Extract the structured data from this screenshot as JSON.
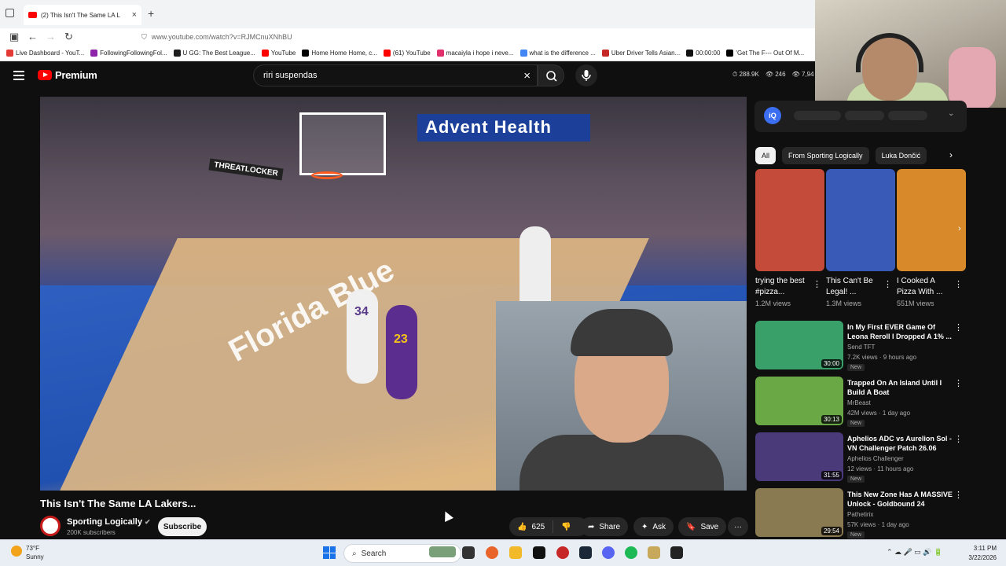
{
  "browser": {
    "tab_title": "(2) This Isn't The Same LA L",
    "tab_close": "×",
    "new_tab": "+",
    "url": "www.youtube.com/watch?v=RJMCnuXNhBU",
    "bookmarks": [
      {
        "label": "Live Dashboard - YouT...",
        "color": "#e53935"
      },
      {
        "label": "FollowingFollowingFol...",
        "color": "#8e24aa"
      },
      {
        "label": "U GG: The Best League...",
        "color": "#1e1e1e"
      },
      {
        "label": "YouTube",
        "color": "#ff0000"
      },
      {
        "label": "Home Home Home, c...",
        "color": "#000000"
      },
      {
        "label": "(61) YouTube",
        "color": "#ff0000"
      },
      {
        "label": "macaiyla i hope i neve...",
        "color": "#e1306c"
      },
      {
        "label": "what is the difference ...",
        "color": "#4285f4"
      },
      {
        "label": "Uber Driver Tells Asian...",
        "color": "#c62828"
      },
      {
        "label": "00:00:00",
        "color": "#111111"
      },
      {
        "label": "'Get The F--- Out Of M...",
        "color": "#000000"
      }
    ]
  },
  "youtube": {
    "logo_label": "Premium",
    "search_value": "riri suspendas",
    "search_clear": "×",
    "stats": [
      "288.9K",
      "246",
      "7,94"
    ]
  },
  "video": {
    "title": "This Isn't The Same LA Lakers...",
    "channel": "Sporting Logically",
    "subscribers": "200K subscribers",
    "subscribe_label": "Subscribe",
    "like_count": "625",
    "share_label": "Share",
    "ask_label": "Ask",
    "save_label": "Save",
    "more_label": "···",
    "scene": {
      "banner": "Advent Health",
      "court_text": "Florida Blue",
      "jersey_34": "34",
      "jersey_23": "23",
      "ad_board": "THREATLOCKER"
    }
  },
  "sidebar": {
    "chips": [
      "All",
      "From Sporting Logically",
      "Luka Dončić"
    ],
    "shorts": [
      {
        "title": "trying the best #pizza...",
        "views": "1.2M views",
        "color": "#c44a3a"
      },
      {
        "title": "This Can't Be Legal! ...",
        "views": "1.3M views",
        "color": "#3a5ab8"
      },
      {
        "title": "I Cooked A Pizza With ...",
        "views": "551M views",
        "color": "#d88a2a"
      }
    ],
    "videos": [
      {
        "title": "In My First EVER Game Of Leona Reroll I Dropped A 1% ...",
        "channel": "Send TFT",
        "meta": "7.2K views · 9 hours ago",
        "duration": "30:00",
        "badge": "New",
        "color": "#3aa06a"
      },
      {
        "title": "Trapped On An Island Until I Build A Boat",
        "channel": "MrBeast",
        "meta": "42M views · 1 day ago",
        "duration": "30:13",
        "badge": "New",
        "color": "#6aa845"
      },
      {
        "title": "Aphelios ADC vs Aurelion Sol - VN Challenger Patch 26.06",
        "channel": "Aphelios Challenger",
        "meta": "12 views · 11 hours ago",
        "duration": "31:55",
        "badge": "New",
        "color": "#4a3a7a"
      },
      {
        "title": "This New Zone Has A MASSIVE Unlock - Goldbound 24",
        "channel": "Pathetirix",
        "meta": "57K views · 1 day ago",
        "duration": "29:54",
        "badge": "New",
        "color": "#8a7a52"
      }
    ]
  },
  "taskbar": {
    "temp": "73°F",
    "condition": "Sunny",
    "search_label": "Search",
    "time": "3:11 PM",
    "date": "3/22/2026"
  }
}
